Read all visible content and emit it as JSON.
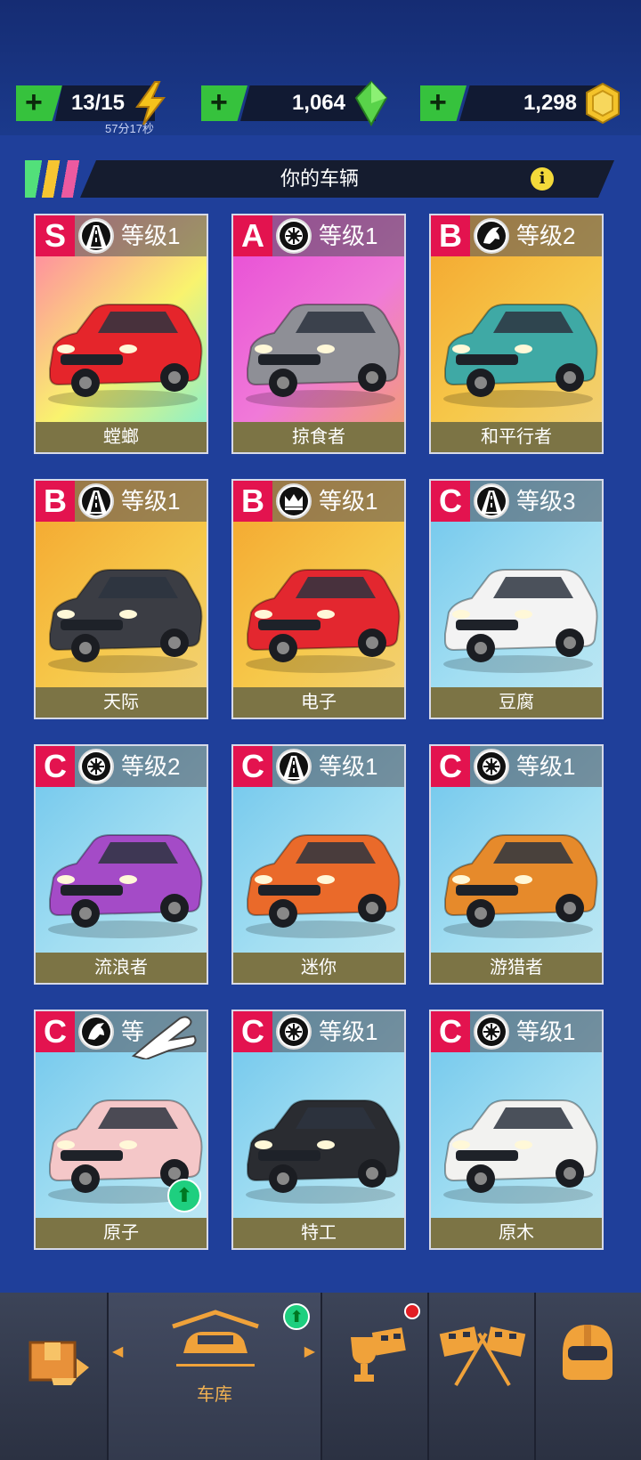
{
  "resources": {
    "energy": {
      "value": "13/15",
      "timer": "57分17秒"
    },
    "gems": {
      "value": "1,064"
    },
    "coins": {
      "value": "1,298"
    }
  },
  "section_title": "你的车辆",
  "cars": [
    {
      "rank": "S",
      "type_icon": "road-icon",
      "level": "等级1",
      "name": "螳螂",
      "bg": [
        "#ff7ca8",
        "#f9f36e",
        "#7af0d9"
      ],
      "body": "#e5252b"
    },
    {
      "rank": "A",
      "type_icon": "tire-icon",
      "level": "等级1",
      "name": "掠食者",
      "bg": [
        "#e84bd6",
        "#f07ad8",
        "#f3a06b"
      ],
      "body": "#8e8f96"
    },
    {
      "rank": "B",
      "type_icon": "horse-icon",
      "level": "等级2",
      "name": "和平行者",
      "bg": [
        "#f4a52e",
        "#f6c84a",
        "#f1d27a"
      ],
      "body": "#3fa9a5"
    },
    {
      "rank": "B",
      "type_icon": "road-icon",
      "level": "等级1",
      "name": "天际",
      "bg": [
        "#f4a52e",
        "#f6c84a",
        "#f1d27a"
      ],
      "body": "#3b3d44"
    },
    {
      "rank": "B",
      "type_icon": "crown-icon",
      "level": "等级1",
      "name": "电子",
      "bg": [
        "#f4a52e",
        "#f6c84a",
        "#f1d27a"
      ],
      "body": "#e3272f"
    },
    {
      "rank": "C",
      "type_icon": "road-icon",
      "level": "等级3",
      "name": "豆腐",
      "bg": [
        "#6fc6ec",
        "#a2def2",
        "#bfe8f3"
      ],
      "body": "#f3f3f3"
    },
    {
      "rank": "C",
      "type_icon": "tire-icon",
      "level": "等级2",
      "name": "流浪者",
      "bg": [
        "#6fc6ec",
        "#a2def2",
        "#bfe8f3"
      ],
      "body": "#a44bc7"
    },
    {
      "rank": "C",
      "type_icon": "road-icon",
      "level": "等级1",
      "name": "迷你",
      "bg": [
        "#6fc6ec",
        "#a2def2",
        "#bfe8f3"
      ],
      "body": "#ea6a2a"
    },
    {
      "rank": "C",
      "type_icon": "tire-icon",
      "level": "等级1",
      "name": "游猎者",
      "bg": [
        "#6fc6ec",
        "#a2def2",
        "#bfe8f3"
      ],
      "body": "#e68a2b"
    },
    {
      "rank": "C",
      "type_icon": "horse-icon",
      "level": "等",
      "name": "原子",
      "bg": [
        "#6fc6ec",
        "#a2def2",
        "#bfe8f3"
      ],
      "body": "#f4c7c8",
      "upgrade": true,
      "pointer": true
    },
    {
      "rank": "C",
      "type_icon": "tire-icon",
      "level": "等级1",
      "name": "特工",
      "bg": [
        "#6fc6ec",
        "#a2def2",
        "#bfe8f3"
      ],
      "body": "#2a2c31"
    },
    {
      "rank": "C",
      "type_icon": "tire-icon",
      "level": "等级1",
      "name": "原木",
      "bg": [
        "#6fc6ec",
        "#a2def2",
        "#bfe8f3"
      ],
      "body": "#f2f2f0"
    }
  ],
  "nav": {
    "garage_label": "车库"
  },
  "colors": {
    "rank": "#e3134f",
    "accent_orange": "#f0a23a",
    "green": "#36c23d",
    "name_bar": "#7c7445"
  }
}
